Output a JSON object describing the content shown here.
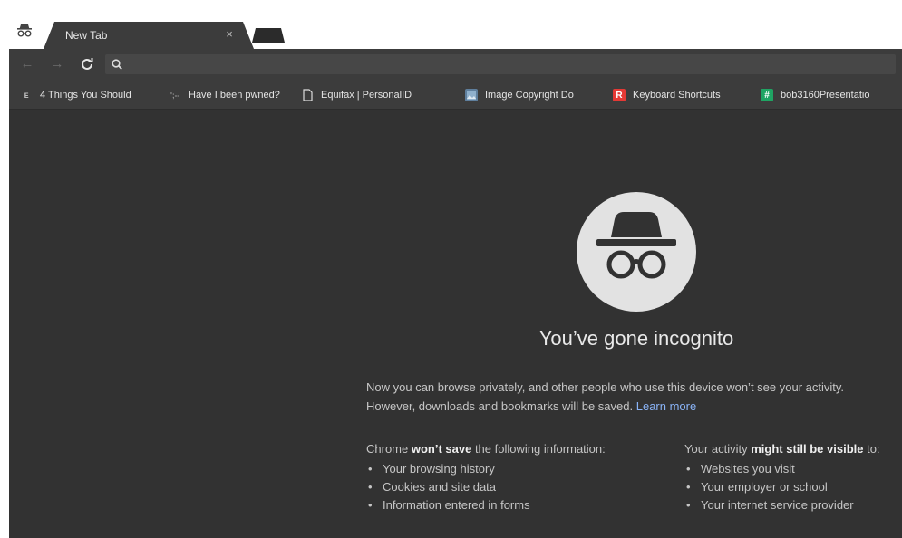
{
  "tab": {
    "title": "New Tab",
    "close": "×"
  },
  "toolbar": {
    "back": "←",
    "forward": "→",
    "reload": "C",
    "omnibox_value": ""
  },
  "bookmarks": [
    {
      "label": "4 Things You Should",
      "icon": "letter-e-icon",
      "glyph": "ᴇ",
      "color": "#bbbbbb"
    },
    {
      "label": "Have I been pwned?",
      "icon": "dashes-icon",
      "glyph": "';--",
      "color": "#9a9a9a"
    },
    {
      "label": "Equifax | PersonalID",
      "icon": "page-icon",
      "glyph": "",
      "color": "#dddddd"
    },
    {
      "label": "Image Copyright Do",
      "icon": "image-icon",
      "glyph": "",
      "color": "#6a8aa8"
    },
    {
      "label": "Keyboard Shortcuts",
      "icon": "pdf-icon",
      "glyph": "R",
      "color": "#e53935"
    },
    {
      "label": "bob3160Presentatio",
      "icon": "sheets-icon",
      "glyph": "#",
      "color": "#1fa463"
    }
  ],
  "page": {
    "heading": "You’ve gone incognito",
    "intro": "Now you can browse privately, and other people who use this device won’t see your activity. However, downloads and bookmarks will be saved.",
    "learn_more": "Learn more",
    "left_head_pre": "Chrome ",
    "left_head_bold": "won’t save",
    "left_head_post": " the following information:",
    "left_items": [
      "Your browsing history",
      "Cookies and site data",
      "Information entered in forms"
    ],
    "right_head_pre": "Your activity ",
    "right_head_bold": "might still be visible",
    "right_head_post": " to:",
    "right_items": [
      "Websites you visit",
      "Your employer or school",
      "Your internet service provider"
    ]
  },
  "colors": {
    "content_bg": "#323232",
    "toolbar_bg": "#3c3c3c",
    "link": "#8ab4f8",
    "avatar": "#e2e2e2"
  }
}
